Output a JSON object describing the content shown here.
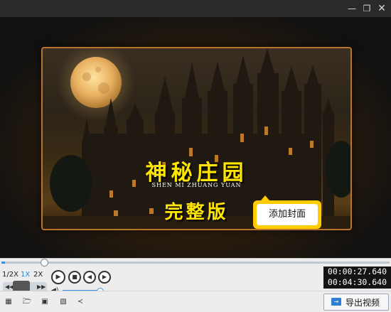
{
  "window": {
    "minimize_icon": "minimize-icon",
    "restore_icon": "restore-icon",
    "close_icon": "close-icon"
  },
  "cover": {
    "title": "神秘庄园",
    "subtitle": "SHEN MI ZHUANG YUAN",
    "edition": "完整版",
    "scene": "gothic castle at night under a full moon",
    "accent_color": "#ffe600",
    "border_color": "#b8742c"
  },
  "tooltip": {
    "label": "添加封面"
  },
  "playback": {
    "progress_fraction": 0.0099,
    "speeds": [
      "1/2X",
      "1X",
      "2X"
    ],
    "active_speed": "1X",
    "volume_fraction": 0.98,
    "current_time": "00:00:27.640",
    "total_time": "00:04:30.640"
  },
  "toolbar": {
    "icons": [
      "document-icon",
      "folder-open-icon",
      "save-icon",
      "save-as-icon",
      "share-icon"
    ],
    "export_label": "导出视频"
  }
}
